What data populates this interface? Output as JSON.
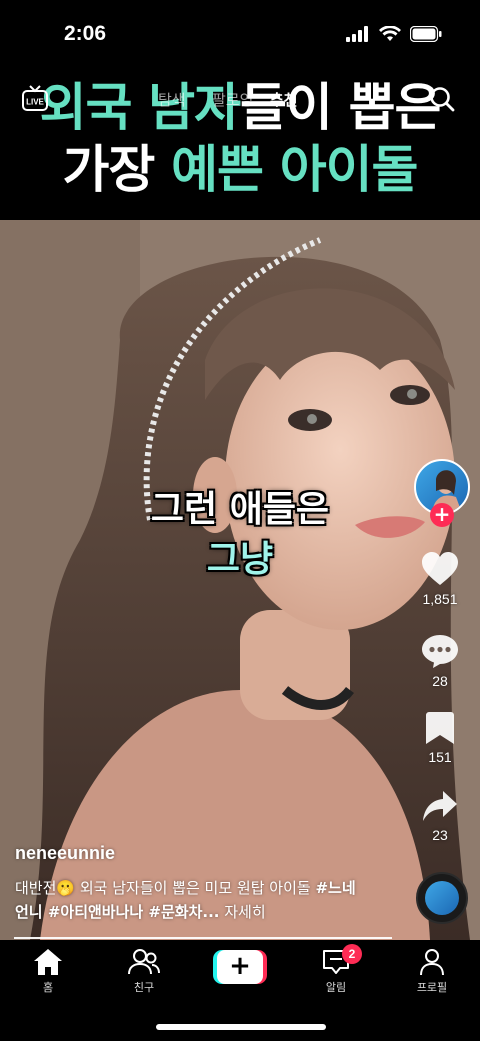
{
  "status_bar": {
    "time": "2:06"
  },
  "top_nav": {
    "live_label": "LIVE",
    "tabs": [
      "탐색",
      "팔로잉",
      "추천"
    ]
  },
  "headline": {
    "line1_accent": "외국 남자",
    "line1_white": "들이 뽑은",
    "line2_white": "가장 ",
    "line2_accent": "예쁜 아이돌"
  },
  "captions": {
    "line1": "그런 애들은",
    "line2": "그냥"
  },
  "actions": {
    "likes": "1,851",
    "comments": "28",
    "saves": "151",
    "shares": "23"
  },
  "post": {
    "username": "neneeunnie",
    "description_text": "대반전🫢 외국 남자들이 뽑은 미모 원탑  아이돌 ",
    "hashtags": "#느네언니 #아티앤바나나 #문화차...",
    "more_label": " 자세히",
    "progress": 1.0
  },
  "bottom_nav": {
    "home": "홈",
    "friends": "친구",
    "inbox": "알림",
    "inbox_badge": "2",
    "profile": "프로필"
  },
  "colors": {
    "accent": "#66e0c2",
    "caption_accent": "#9ff3ea",
    "like_red": "#fe2c55",
    "create_cyan": "#25f4ee"
  }
}
